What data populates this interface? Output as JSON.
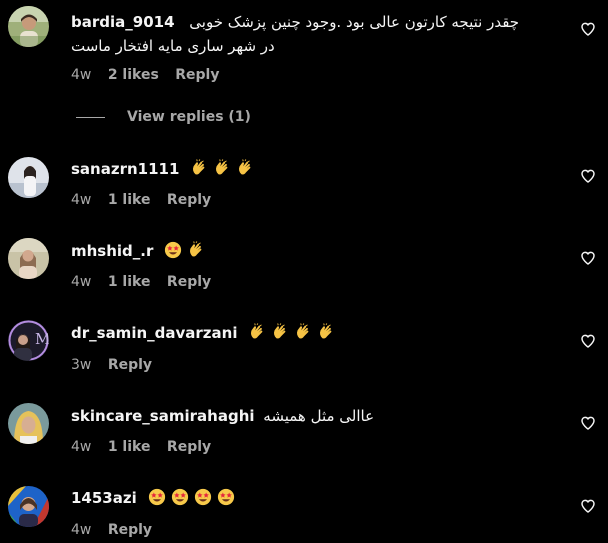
{
  "colors": {
    "background": "#000000",
    "primary_text": "#f5f5f5",
    "secondary_text": "#a8a8a8"
  },
  "comments": [
    {
      "username": "bardia_9014",
      "text": "چقدر نتیجه کارتون عالی بود .وجود چنین پزشک خوبی",
      "text_line2": "در شهر ساری مایه افتخار ماست",
      "time": "4w",
      "likes": "2 likes",
      "reply": "Reply",
      "emojis": []
    },
    {
      "username": "sanazrn1111",
      "text": "",
      "time": "4w",
      "likes": "1 like",
      "reply": "Reply",
      "emojis": [
        "clapping-hands",
        "clapping-hands",
        "clapping-hands"
      ]
    },
    {
      "username": "mhshid_.r",
      "text": "",
      "time": "4w",
      "likes": "1 like",
      "reply": "Reply",
      "emojis": [
        "star-struck",
        "clapping-hands"
      ]
    },
    {
      "username": "dr_samin_davarzani",
      "text": "",
      "time": "3w",
      "likes": "",
      "reply": "Reply",
      "emojis": [
        "clapping-hands",
        "clapping-hands",
        "clapping-hands",
        "clapping-hands"
      ]
    },
    {
      "username": "skincare_samirahaghi",
      "text": "عاالی مثل همیشه",
      "time": "4w",
      "likes": "1 like",
      "reply": "Reply",
      "emojis": []
    },
    {
      "username": "1453azi",
      "text": "",
      "time": "4w",
      "likes": "",
      "reply": "Reply",
      "emojis": [
        "star-struck",
        "star-struck",
        "star-struck",
        "star-struck"
      ]
    }
  ],
  "view_replies": "View replies (1)",
  "icons": {
    "like": "heart-outline-icon"
  }
}
